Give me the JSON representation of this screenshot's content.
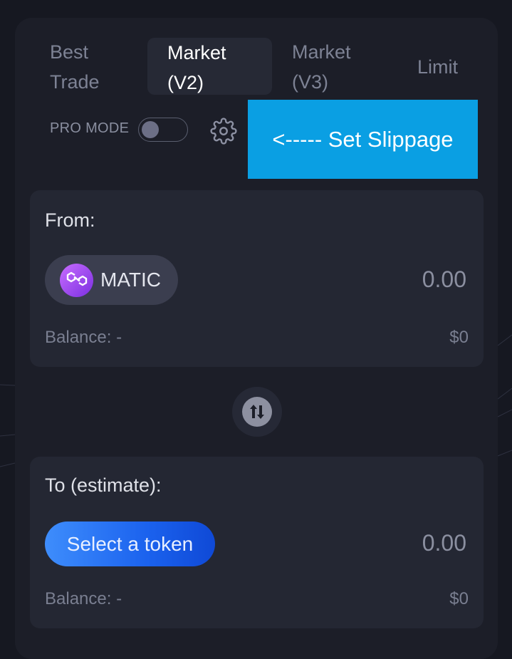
{
  "tabs": [
    {
      "label": "Best\nTrade",
      "active": false
    },
    {
      "label": "Market\n(V2)",
      "active": true
    },
    {
      "label": "Market\n(V3)",
      "active": false
    },
    {
      "label": "Limit",
      "active": false
    }
  ],
  "pro_mode": {
    "label": "PRO MODE",
    "enabled": false
  },
  "callout": {
    "text": "<----- Set Slippage"
  },
  "from": {
    "title": "From:",
    "token": {
      "symbol": "MATIC",
      "icon": "polygon-logo-icon"
    },
    "amount_placeholder": "0.00",
    "balance_label": "Balance: -",
    "usd_value": "$0"
  },
  "to": {
    "title": "To (estimate):",
    "select_label": "Select a token",
    "amount_placeholder": "0.00",
    "balance_label": "Balance: -",
    "usd_value": "$0"
  },
  "colors": {
    "background": "#161821",
    "card": "#1c1e28",
    "panel": "#242733",
    "callout": "#0a9fe3",
    "accent_gradient_start": "#3e8dfc",
    "accent_gradient_end": "#0f49d6"
  },
  "icons": {
    "settings": "gear-icon",
    "swap": "swap-arrows-icon"
  }
}
